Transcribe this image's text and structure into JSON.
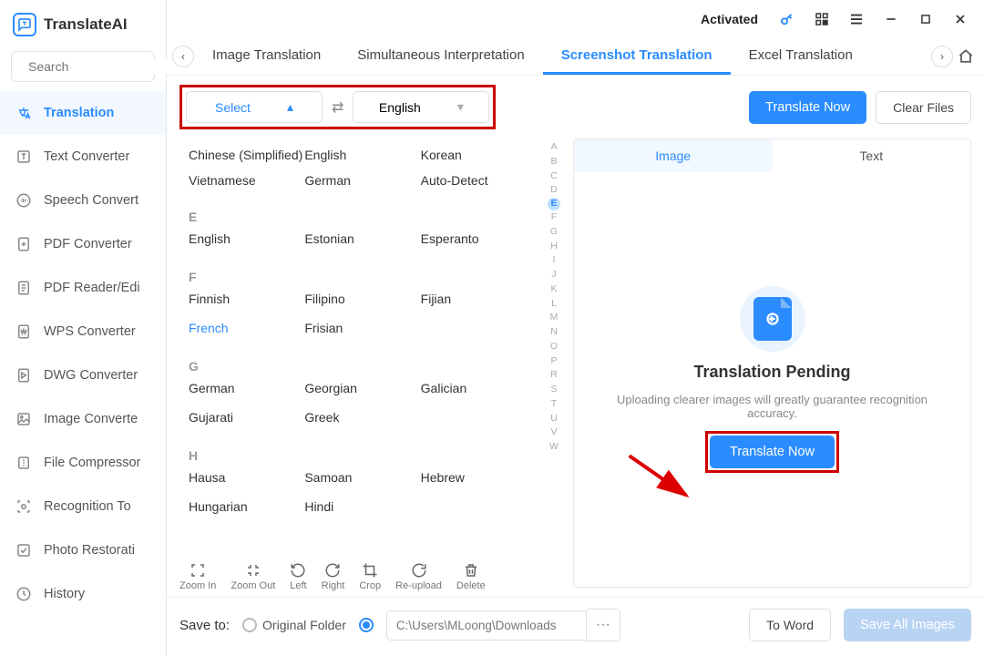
{
  "app": {
    "name": "TranslateAI"
  },
  "search": {
    "placeholder": "Search"
  },
  "sidebar": {
    "items": [
      {
        "label": "Translation"
      },
      {
        "label": "Text Converter"
      },
      {
        "label": "Speech Convert"
      },
      {
        "label": "PDF Converter"
      },
      {
        "label": "PDF Reader/Edi"
      },
      {
        "label": "WPS Converter"
      },
      {
        "label": "DWG Converter"
      },
      {
        "label": "Image Converte"
      },
      {
        "label": "File Compressor"
      },
      {
        "label": "Recognition To"
      },
      {
        "label": "Photo Restorati"
      },
      {
        "label": "History"
      }
    ]
  },
  "titlebar": {
    "activated": "Activated"
  },
  "tabs": [
    {
      "label": "Image Translation"
    },
    {
      "label": "Simultaneous Interpretation"
    },
    {
      "label": "Screenshot Translation"
    },
    {
      "label": "Excel Translation"
    }
  ],
  "lang": {
    "source": "Select",
    "target": "English",
    "top_row": [
      "Chinese (Simplified)",
      "English",
      "Korean"
    ],
    "top_row2": [
      "Vietnamese",
      "German",
      "Auto-Detect"
    ],
    "sections": [
      {
        "letter": "E",
        "rows": [
          [
            "English",
            "Estonian",
            "Esperanto"
          ]
        ]
      },
      {
        "letter": "F",
        "rows": [
          [
            "Finnish",
            "Filipino",
            "Fijian"
          ],
          [
            "French",
            "Frisian",
            ""
          ]
        ]
      },
      {
        "letter": "G",
        "rows": [
          [
            "German",
            "Georgian",
            "Galician"
          ],
          [
            "Gujarati",
            "Greek",
            ""
          ]
        ]
      },
      {
        "letter": "H",
        "rows": [
          [
            "Hausa",
            "Samoan",
            "Hebrew"
          ],
          [
            "Hungarian",
            "Hindi",
            ""
          ]
        ]
      }
    ],
    "az": [
      "A",
      "B",
      "C",
      "D",
      "E",
      "F",
      "G",
      "H",
      "I",
      "J",
      "K",
      "L",
      "M",
      "N",
      "O",
      "P",
      "R",
      "S",
      "T",
      "U",
      "V",
      "W"
    ],
    "az_selected": "E"
  },
  "toolbar": {
    "translate": "Translate Now",
    "clear": "Clear Files"
  },
  "image_tools": [
    "Zoom In",
    "Zoom Out",
    "Left",
    "Right",
    "Crop",
    "Re-upload",
    "Delete"
  ],
  "right": {
    "tabs": [
      "Image",
      "Text"
    ],
    "title": "Translation Pending",
    "desc": "Uploading clearer images will greatly guarantee recognition accuracy.",
    "button": "Translate Now"
  },
  "footer": {
    "label": "Save to:",
    "option_original": "Original Folder",
    "path": "C:\\Users\\MLoong\\Downloads",
    "to_word": "To Word",
    "save_all": "Save All Images"
  }
}
